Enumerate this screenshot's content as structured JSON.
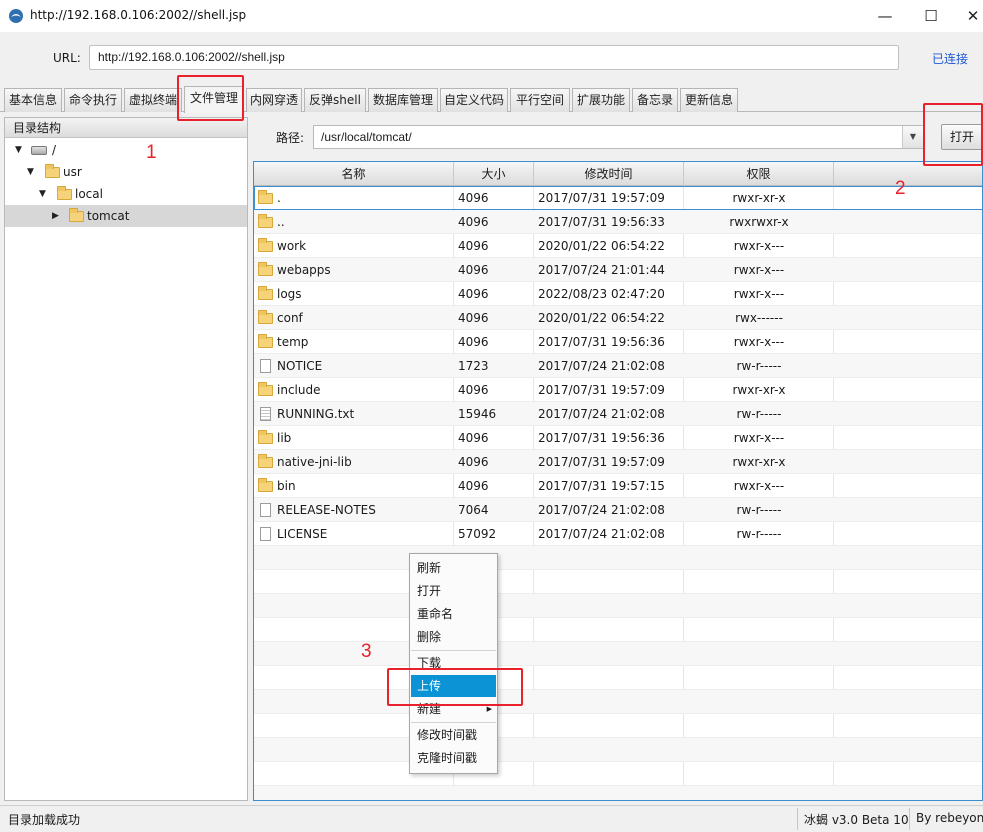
{
  "window": {
    "title": "http://192.168.0.106:2002//shell.jsp",
    "minimize": "—",
    "maximize": "☐",
    "close": "✕"
  },
  "urlbar": {
    "label": "URL:",
    "value": "http://192.168.0.106:2002//shell.jsp",
    "status": "已连接"
  },
  "tabs": [
    {
      "label": "基本信息"
    },
    {
      "label": "命令执行"
    },
    {
      "label": "虚拟终端"
    },
    {
      "label": "文件管理",
      "active": true
    },
    {
      "label": "内网穿透"
    },
    {
      "label": "反弹shell"
    },
    {
      "label": "数据库管理"
    },
    {
      "label": "自定义代码"
    },
    {
      "label": "平行空间"
    },
    {
      "label": "扩展功能"
    },
    {
      "label": "备忘录"
    },
    {
      "label": "更新信息"
    }
  ],
  "tree": {
    "header": "目录结构",
    "nodes": [
      {
        "label": "/",
        "expanded": true
      },
      {
        "label": "usr",
        "expanded": true
      },
      {
        "label": "local",
        "expanded": true
      },
      {
        "label": "tomcat",
        "expanded": false,
        "selected": true
      }
    ]
  },
  "pathbar": {
    "label": "路径:",
    "value": "/usr/local/tomcat/",
    "open_label": "打开"
  },
  "table": {
    "columns": [
      "名称",
      "大小",
      "修改时间",
      "权限"
    ],
    "rows": [
      {
        "name": ".",
        "size": "4096",
        "mtime": "2017/07/31 19:57:09",
        "perm": "rwxr-xr-x",
        "kind": "folder"
      },
      {
        "name": "..",
        "size": "4096",
        "mtime": "2017/07/31 19:56:33",
        "perm": "rwxrwxr-x",
        "kind": "folder"
      },
      {
        "name": "work",
        "size": "4096",
        "mtime": "2020/01/22 06:54:22",
        "perm": "rwxr-x---",
        "kind": "folder"
      },
      {
        "name": "webapps",
        "size": "4096",
        "mtime": "2017/07/24 21:01:44",
        "perm": "rwxr-x---",
        "kind": "folder"
      },
      {
        "name": "logs",
        "size": "4096",
        "mtime": "2022/08/23 02:47:20",
        "perm": "rwxr-x---",
        "kind": "folder"
      },
      {
        "name": "conf",
        "size": "4096",
        "mtime": "2020/01/22 06:54:22",
        "perm": "rwx------",
        "kind": "folder"
      },
      {
        "name": "temp",
        "size": "4096",
        "mtime": "2017/07/31 19:56:36",
        "perm": "rwxr-x---",
        "kind": "folder"
      },
      {
        "name": "NOTICE",
        "size": "1723",
        "mtime": "2017/07/24 21:02:08",
        "perm": "rw-r-----",
        "kind": "file"
      },
      {
        "name": "include",
        "size": "4096",
        "mtime": "2017/07/31 19:57:09",
        "perm": "rwxr-xr-x",
        "kind": "folder"
      },
      {
        "name": "RUNNING.txt",
        "size": "15946",
        "mtime": "2017/07/24 21:02:08",
        "perm": "rw-r-----",
        "kind": "text"
      },
      {
        "name": "lib",
        "size": "4096",
        "mtime": "2017/07/31 19:56:36",
        "perm": "rwxr-x---",
        "kind": "folder"
      },
      {
        "name": "native-jni-lib",
        "size": "4096",
        "mtime": "2017/07/31 19:57:09",
        "perm": "rwxr-xr-x",
        "kind": "folder"
      },
      {
        "name": "bin",
        "size": "4096",
        "mtime": "2017/07/31 19:57:15",
        "perm": "rwxr-x---",
        "kind": "folder"
      },
      {
        "name": "RELEASE-NOTES",
        "size": "7064",
        "mtime": "2017/07/24 21:02:08",
        "perm": "rw-r-----",
        "kind": "file"
      },
      {
        "name": "LICENSE",
        "size": "57092",
        "mtime": "2017/07/24 21:02:08",
        "perm": "rw-r-----",
        "kind": "file"
      }
    ]
  },
  "context_menu": {
    "items": [
      {
        "label": "刷新"
      },
      {
        "label": "打开"
      },
      {
        "label": "重命名"
      },
      {
        "label": "删除"
      },
      {
        "label": "下载"
      },
      {
        "label": "上传",
        "active": true
      },
      {
        "label": "新建",
        "submenu": true
      },
      {
        "label": "修改时间戳"
      },
      {
        "label": "克隆时间戳"
      }
    ],
    "submenu_arrow": "▶"
  },
  "annotations": {
    "marker_1": "1",
    "marker_2": "2",
    "marker_3": "3",
    "color": "#e8212a"
  },
  "statusbar": {
    "message": "目录加载成功",
    "version": "冰蝎 v3.0 Beta 10",
    "author": "By rebeyond"
  },
  "colors": {
    "selection_blue": "#0b93d5",
    "link_blue": "#1f58d4",
    "table_border": "#3d8ed1"
  }
}
